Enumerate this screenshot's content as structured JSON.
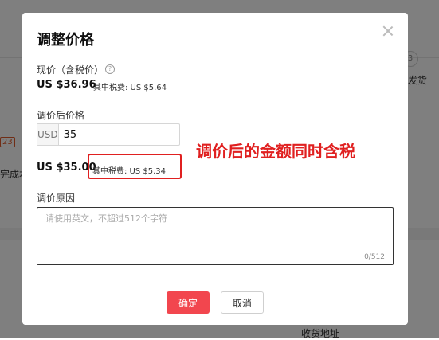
{
  "background": {
    "circle_badge": "3",
    "right_text": "发货",
    "left_badge": "23",
    "left_text": "完成本",
    "bottom_text": "收货地址"
  },
  "modal": {
    "title": "调整价格",
    "current_price_label": "现价（含税价）",
    "help_glyph": "?",
    "current_price": "US $36.96",
    "current_tax": "其中税费: US $5.64",
    "new_price_label": "调价后价格",
    "currency": "USD",
    "new_price_value": "35",
    "new_price_display": "US $35.00",
    "new_tax": "其中税费: US $5.34",
    "annotation": "调价后的金额同时含税",
    "reason_label": "调价原因",
    "reason_placeholder": "请使用英文，不超过512个字符",
    "reason_count": "0/512",
    "confirm_label": "确定",
    "cancel_label": "取消"
  },
  "colors": {
    "accent_red": "#f2464e",
    "annotation_red": "#e02020"
  }
}
